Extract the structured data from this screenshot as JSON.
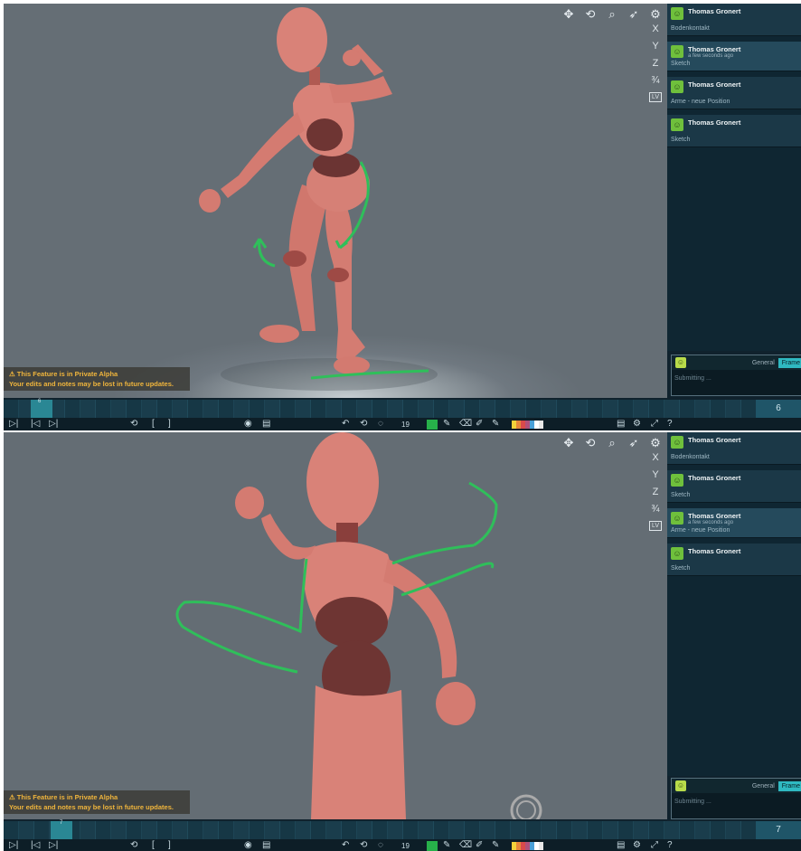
{
  "toolbar_icons": {
    "move": "✥",
    "orbit": "⟲",
    "zoom": "⌕",
    "pointer": "➶",
    "gear": "⚙"
  },
  "axes": [
    "X",
    "Y",
    "Z",
    "¾",
    "LV"
  ],
  "alpha_notice": {
    "line1": "⚠  This Feature is in Private Alpha",
    "line2": "Your edits and notes may be lost in future updates."
  },
  "panel1": {
    "notes": [
      {
        "author": "Thomas Gronert",
        "time": "",
        "text": "Bodenkontakt",
        "highlight": false
      },
      {
        "author": "Thomas Gronert",
        "time": "a few seconds ago",
        "text": "Sketch",
        "highlight": true
      },
      {
        "author": "Thomas Gronert",
        "time": "",
        "text": "Arme - neue Position",
        "highlight": false
      },
      {
        "author": "Thomas Gronert",
        "time": "",
        "text": "Sketch",
        "highlight": false
      }
    ],
    "compose": {
      "tab_general": "General",
      "tab_frame": "Frame",
      "status": "Submitting ..."
    },
    "timeline": {
      "playhead_label": "6",
      "frame_number": "6"
    }
  },
  "panel2": {
    "notes": [
      {
        "author": "Thomas Gronert",
        "time": "",
        "text": "Bodenkontakt",
        "highlight": false
      },
      {
        "author": "Thomas Gronert",
        "time": "",
        "text": "Sketch",
        "highlight": false
      },
      {
        "author": "Thomas Gronert",
        "time": "a few seconds ago",
        "text": "Arme - neue Position",
        "highlight": true
      },
      {
        "author": "Thomas Gronert",
        "time": "",
        "text": "Sketch",
        "highlight": false
      }
    ],
    "compose": {
      "tab_general": "General",
      "tab_frame": "Frame",
      "status": "Submitting ..."
    },
    "timeline": {
      "playhead_label": "7",
      "frame_number": "7"
    }
  },
  "bottom_toolbar": {
    "play": "▷|",
    "prev_key": "|◁",
    "next_key": "▷|",
    "loop": "⟲",
    "bracket_open": "[",
    "bracket_close": "]",
    "visibility": "◉",
    "film": "▤",
    "undo": "↶",
    "redo": "⟲",
    "ghost": "◌",
    "brush_size": "19",
    "pencil": "✎",
    "eraser": "⌫",
    "picker": "✐",
    "marker": "✎",
    "doc": "▤",
    "settings": "⚙",
    "fullscreen": "⤢",
    "help": "?"
  },
  "colors": {
    "stroke": "#2fbf5a",
    "figure": "#d67a70",
    "figure_dark": "#6b3433",
    "accent": "#2fb9c1",
    "swatches": [
      "#f2d23a",
      "#e6883a",
      "#d94a4a",
      "#b0507a",
      "#4aa0d8",
      "#ffffff",
      "#e8e8e8"
    ]
  }
}
